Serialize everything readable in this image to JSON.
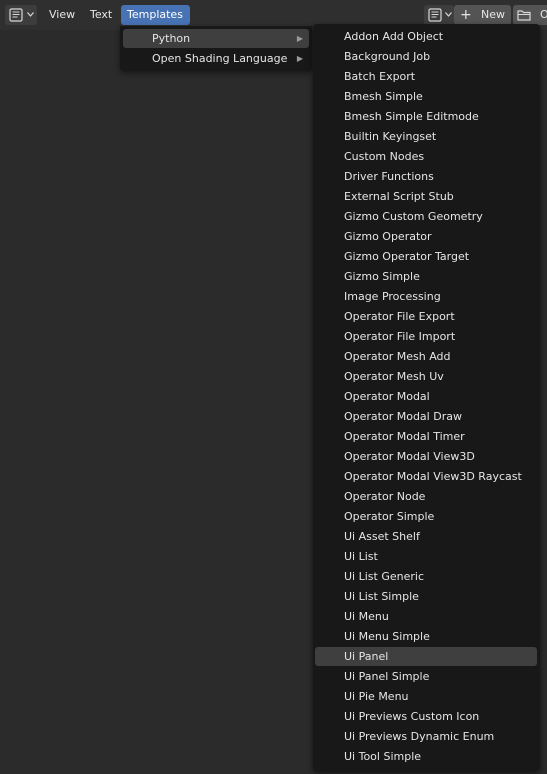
{
  "header": {
    "menus": [
      "View",
      "Text",
      "Templates"
    ],
    "active_menu": "Templates",
    "new_label": "New",
    "open_label": "O"
  },
  "submenu": {
    "items": [
      {
        "label": "Python",
        "highlighted": true
      },
      {
        "label": "Open Shading Language",
        "highlighted": false
      }
    ]
  },
  "templates": {
    "highlighted": "Ui Panel",
    "items": [
      "Addon Add Object",
      "Background Job",
      "Batch Export",
      "Bmesh Simple",
      "Bmesh Simple Editmode",
      "Builtin Keyingset",
      "Custom Nodes",
      "Driver Functions",
      "External Script Stub",
      "Gizmo Custom Geometry",
      "Gizmo Operator",
      "Gizmo Operator Target",
      "Gizmo Simple",
      "Image Processing",
      "Operator File Export",
      "Operator File Import",
      "Operator Mesh Add",
      "Operator Mesh Uv",
      "Operator Modal",
      "Operator Modal Draw",
      "Operator Modal Timer",
      "Operator Modal View3D",
      "Operator Modal View3D Raycast",
      "Operator Node",
      "Operator Simple",
      "Ui Asset Shelf",
      "Ui List",
      "Ui List Generic",
      "Ui List Simple",
      "Ui Menu",
      "Ui Menu Simple",
      "Ui Panel",
      "Ui Panel Simple",
      "Ui Pie Menu",
      "Ui Previews Custom Icon",
      "Ui Previews Dynamic Enum",
      "Ui Tool Simple"
    ]
  },
  "icons": {
    "editor_type": "text-editor-icon",
    "chevron": "chevron-down-icon",
    "new": "plus-icon",
    "open": "folder-icon",
    "submenu_arrow": "triangle-right-icon"
  },
  "colors": {
    "accent": "#4772b3",
    "menu_bg": "#181818",
    "highlight": "#3f3f3f",
    "header_bg": "#2f2f2f",
    "area_bg": "#2b2b2b"
  }
}
